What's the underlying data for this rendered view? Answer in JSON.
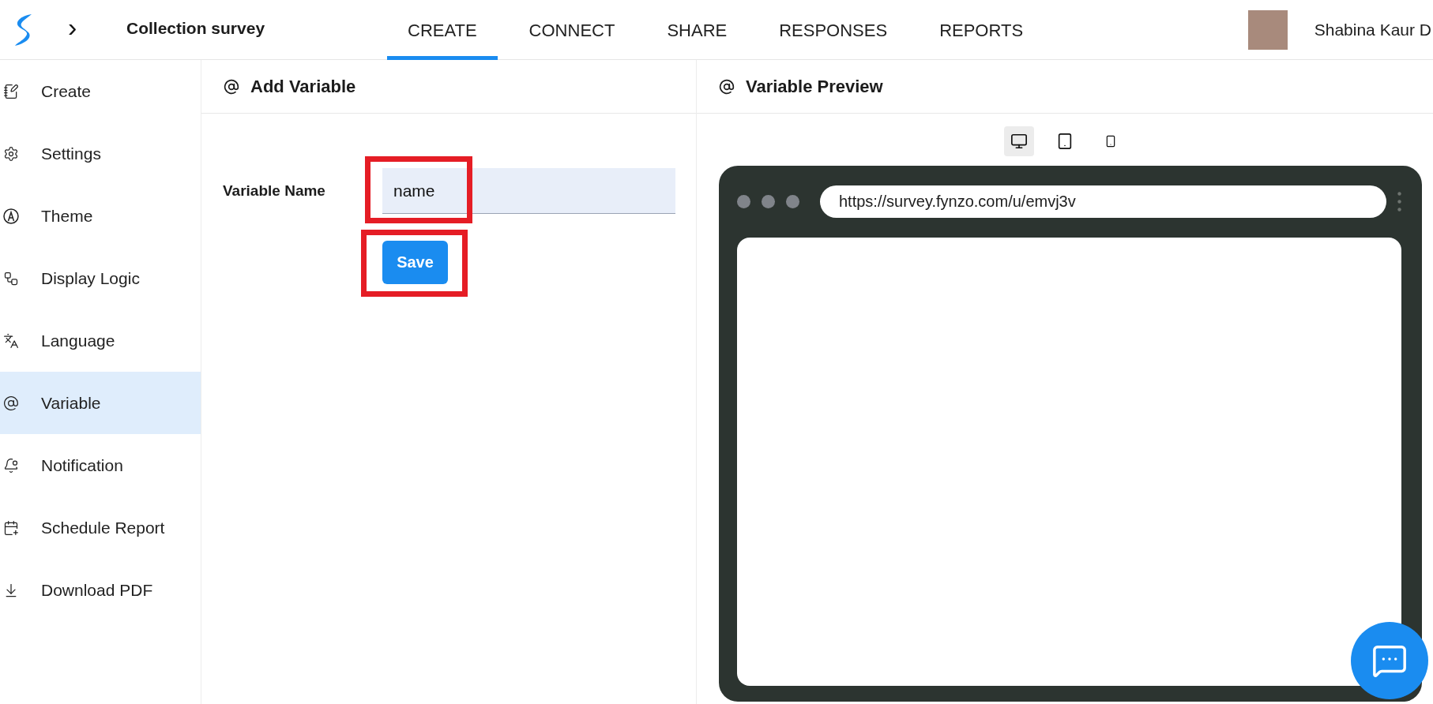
{
  "header": {
    "breadcrumb_arrow": "›",
    "survey_title": "Collection survey",
    "user_name": "Shabina Kaur D"
  },
  "tabs": [
    {
      "label": "CREATE",
      "selected": true
    },
    {
      "label": "CONNECT",
      "selected": false
    },
    {
      "label": "SHARE",
      "selected": false
    },
    {
      "label": "RESPONSES",
      "selected": false
    },
    {
      "label": "REPORTS",
      "selected": false
    }
  ],
  "sidebar": {
    "items": [
      {
        "label": "Create",
        "selected": false
      },
      {
        "label": "Settings",
        "selected": false
      },
      {
        "label": "Theme",
        "selected": false
      },
      {
        "label": "Display Logic",
        "selected": false
      },
      {
        "label": "Language",
        "selected": false
      },
      {
        "label": "Variable",
        "selected": true
      },
      {
        "label": "Notification",
        "selected": false
      },
      {
        "label": "Schedule Report",
        "selected": false
      },
      {
        "label": "Download PDF",
        "selected": false
      }
    ]
  },
  "add_variable": {
    "title": "Add Variable",
    "field_label": "Variable Name",
    "field_value": "name",
    "field_highlighted": true,
    "save_label": "Save",
    "save_highlighted": true
  },
  "preview": {
    "title": "Variable Preview",
    "devices": [
      {
        "selected": true
      },
      {
        "selected": false
      },
      {
        "selected": false
      }
    ],
    "url": "https://survey.fynzo.com/u/emvj3v"
  }
}
